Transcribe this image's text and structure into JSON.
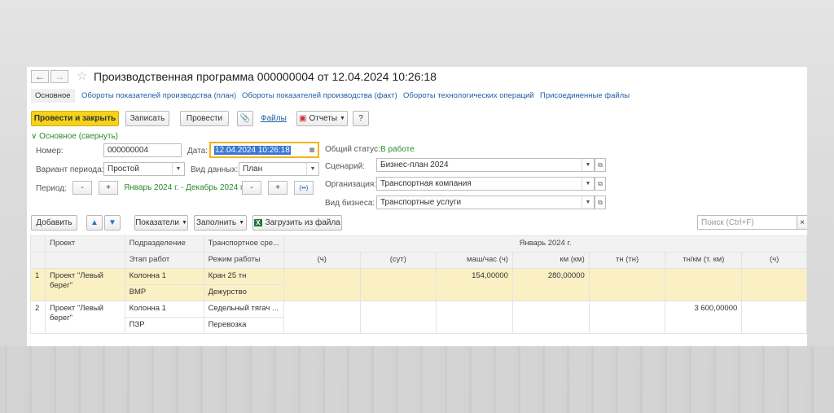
{
  "window": {
    "title": "Производственная программа 000000004 от 12.04.2024 10:26:18",
    "tabs": [
      "Основное",
      "Обороты показателей производства (план)",
      "Обороты показателей производства (факт)",
      "Обороты технологических операций",
      "Присоединенные файлы"
    ]
  },
  "toolbar": {
    "post_close": "Провести и закрыть",
    "save": "Записать",
    "post": "Провести",
    "files": "Файлы",
    "reports": "Отчеты",
    "help": "?"
  },
  "section": {
    "label": "Основное (свернуть)"
  },
  "form": {
    "number_label": "Номер:",
    "number": "000000004",
    "date_label": "Дата:",
    "date": "12.04.2024 10:26:18",
    "period_variant_label": "Вариант периода:",
    "period_variant": "Простой",
    "data_kind_label": "Вид данных:",
    "data_kind": "План",
    "period_label": "Период:",
    "period": "Январь 2024 г. - Декабрь 2024 г.",
    "status_label": "Общий статус:",
    "status": "В работе",
    "scenario_label": "Сценарий:",
    "scenario": "Бизнес-план 2024",
    "org_label": "Организация:",
    "org": "Транспортная компания",
    "business_label": "Вид бизнеса:",
    "business": "Транспортные услуги",
    "minus": "-",
    "plus": "+"
  },
  "table_toolbar": {
    "add": "Добавить",
    "indicators": "Показатели",
    "fill": "Заполнить",
    "load": "Загрузить из файла",
    "search_placeholder": "Поиск (Ctrl+F)",
    "clear": "×"
  },
  "grid": {
    "head1": [
      "Проект",
      "Подразделение",
      "Транспортное сре...",
      "Январь 2024 г."
    ],
    "head2": [
      "Этап работ",
      "Режим работы",
      "(ч)",
      "(сут)",
      "маш/час (ч)",
      "км (км)",
      "тн (тн)",
      "тн/км (т. км)",
      "(ч)"
    ],
    "rows": [
      {
        "n": "1",
        "project": "Проект \"Левый берег\"",
        "dept": "Колонна 1",
        "stage": "ВМР",
        "vehicle": "Кран 25 тн",
        "mode": "Дежурство",
        "v1": "",
        "v2": "",
        "v3": "154,00000",
        "v4": "280,00000",
        "v5": "",
        "v6": "",
        "v7": ""
      },
      {
        "n": "2",
        "project": "Проект \"Левый берег\"",
        "dept": "Колонна 1",
        "stage": "ПЗР",
        "vehicle": "Седельный тягач ...",
        "mode": "Перевозка",
        "v1": "",
        "v2": "",
        "v3": "",
        "v4": "",
        "v5": "",
        "v6": "3 600,00000",
        "v7": ""
      }
    ]
  },
  "colors": {
    "accent": "#f6d31a",
    "link": "#1f5fa5",
    "status": "#2c8a2c",
    "row_selected": "#fbf0c4"
  }
}
